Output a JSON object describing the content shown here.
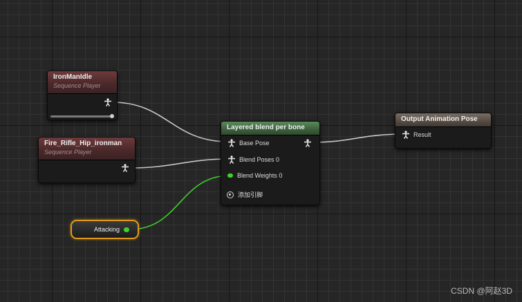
{
  "graph": {
    "nodes": {
      "iron_idle": {
        "title": "IronManIdle",
        "subtitle": "Sequence Player"
      },
      "fire_rifle": {
        "title": "Fire_Rifle_Hip_ironman",
        "subtitle": "Sequence Player"
      },
      "blend": {
        "title": "Layered blend per bone",
        "pins": {
          "base_pose": "Base Pose",
          "blend_poses": "Blend Poses 0",
          "blend_weights": "Blend Weights 0",
          "add_pin": "添加引脚"
        }
      },
      "output": {
        "title": "Output Animation Pose",
        "pins": {
          "result": "Result"
        }
      },
      "attacking": {
        "label": "Attacking"
      }
    },
    "colors": {
      "pose_wire": "#c8c8c8",
      "bool_wire": "#3ed12c",
      "variable_highlight": "#e39b16"
    },
    "icons": {
      "pose_pin": "person-pose-icon",
      "bool_pin": "bool-pin-icon",
      "add_pin": "add-circle-icon"
    }
  },
  "watermark": "CSDN @阿赵3D"
}
